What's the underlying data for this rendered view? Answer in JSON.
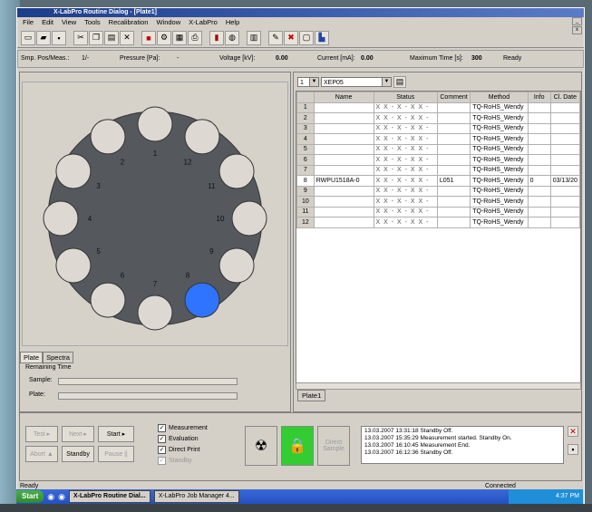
{
  "window": {
    "title": "X-LabPro Routine Dialog - [Plate1]"
  },
  "menu": [
    "File",
    "Edit",
    "View",
    "Tools",
    "Recalibration",
    "Window",
    "X-LabPro",
    "Help"
  ],
  "status_row": {
    "smp_label": "Smp. Pos/Meas.:",
    "smp_value": "1/-",
    "pressure_label": "Pressure [Pa]:",
    "pressure_value": "-",
    "voltage_label": "Voltage [kV]:",
    "voltage_value": "0.00",
    "current_label": "Current [mA]:",
    "current_value": "0.00",
    "maxtime_label": "Maximum Time [s]:",
    "maxtime_value": "300",
    "state": "Ready"
  },
  "carousel": {
    "positions": [
      "1",
      "2",
      "3",
      "4",
      "5",
      "6",
      "7",
      "8",
      "9",
      "10",
      "11",
      "12"
    ],
    "active_position": "8"
  },
  "left_tabs": [
    "Plate",
    "Spectra"
  ],
  "remaining": {
    "title": "Remaining Time",
    "sample_label": "Sample:",
    "plate_label": "Plate:"
  },
  "tray_select": {
    "number": "1",
    "name": "XEP05"
  },
  "table": {
    "headers": [
      "Name",
      "Status",
      "Comment",
      "Method",
      "Info",
      "Cl. Date"
    ],
    "rows": [
      {
        "n": "1",
        "name": "",
        "status": "X X - X - X X -",
        "comment": "",
        "method": "TQ-RoHS_Wendy",
        "info": "",
        "date": ""
      },
      {
        "n": "2",
        "name": "",
        "status": "X X - X - X X -",
        "comment": "",
        "method": "TQ-RoHS_Wendy",
        "info": "",
        "date": ""
      },
      {
        "n": "3",
        "name": "",
        "status": "X X - X - X X -",
        "comment": "",
        "method": "TQ-RoHS_Wendy",
        "info": "",
        "date": ""
      },
      {
        "n": "4",
        "name": "",
        "status": "X X - X - X X -",
        "comment": "",
        "method": "TQ-RoHS_Wendy",
        "info": "",
        "date": ""
      },
      {
        "n": "5",
        "name": "",
        "status": "X X - X - X X -",
        "comment": "",
        "method": "TQ-RoHS_Wendy",
        "info": "",
        "date": ""
      },
      {
        "n": "6",
        "name": "",
        "status": "X X - X - X X -",
        "comment": "",
        "method": "TQ-RoHS_Wendy",
        "info": "",
        "date": ""
      },
      {
        "n": "7",
        "name": "",
        "status": "X X - X - X X -",
        "comment": "",
        "method": "TQ-RoHS_Wendy",
        "info": "",
        "date": ""
      },
      {
        "n": "8",
        "name": "RWPU1518A-0",
        "status": "X X - X - X X -",
        "comment": "L051",
        "method": "TQ-RoHS_Wendy",
        "info": "0",
        "date": "03/13/20"
      },
      {
        "n": "9",
        "name": "",
        "status": "X X - X - X X -",
        "comment": "",
        "method": "TQ-RoHS_Wendy",
        "info": "",
        "date": ""
      },
      {
        "n": "10",
        "name": "",
        "status": "X X - X - X X -",
        "comment": "",
        "method": "TQ-RoHS_Wendy",
        "info": "",
        "date": ""
      },
      {
        "n": "11",
        "name": "",
        "status": "X X - X - X X -",
        "comment": "",
        "method": "TQ-RoHS_Wendy",
        "info": "",
        "date": ""
      },
      {
        "n": "12",
        "name": "",
        "status": "X X - X - X X -",
        "comment": "",
        "method": "TQ-RoHS_Wendy",
        "info": "",
        "date": ""
      }
    ]
  },
  "plate_tab": "Plate1",
  "controls": {
    "test": "Test",
    "next": "Next",
    "start": "Start",
    "abort": "Abort",
    "standby": "Standby",
    "pause": "Pause"
  },
  "checks": [
    {
      "label": "Measurement",
      "checked": true
    },
    {
      "label": "Evaluation",
      "checked": true
    },
    {
      "label": "Direct Print",
      "checked": true
    },
    {
      "label": "Standby",
      "checked": true
    }
  ],
  "direct_sample": "Direct Sample",
  "log": [
    "13.03.2007 13:31:18  Standby Off.",
    "13.03.2007 15:35:29  Measurement started. Standby On.",
    "13.03.2007 16:10:45  Measurement End.",
    "13.03.2007 16:12:36  Standby Off."
  ],
  "statusbar": {
    "left": "Ready",
    "connected": "Connected"
  },
  "taskbar": {
    "start": "Start",
    "items": [
      "X-LabPro Routine Dial...",
      "X-LabPro Job Manager 4..."
    ],
    "clock": "4:37 PM"
  },
  "colors": {
    "active_slot": "#2f74ff",
    "disk": "#55595e",
    "slot": "#ddd9d2",
    "ok_button": "#33cc33"
  }
}
